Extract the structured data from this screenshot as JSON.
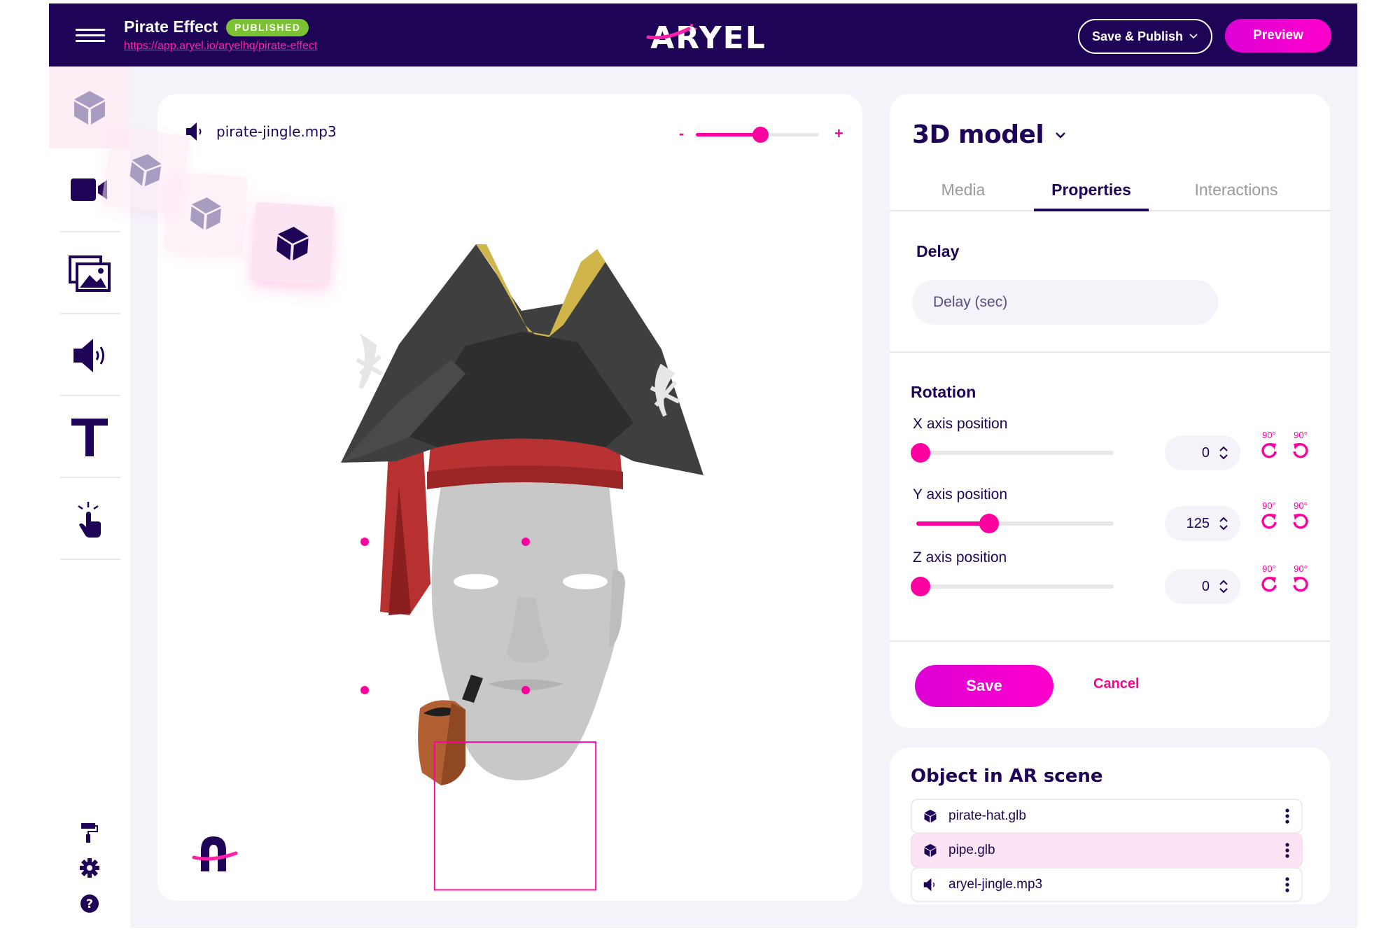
{
  "header": {
    "project_title": "Pirate Effect",
    "status_badge": "PUBLISHED",
    "project_url": "https://app.aryel.io/aryelhq/pirate-effect",
    "logo_text": "ARYEL",
    "save_publish_label": "Save & Publish",
    "preview_label": "Preview"
  },
  "sidebar": {
    "items": [
      {
        "icon": "cube-icon",
        "label": "3D model",
        "active": true
      },
      {
        "icon": "video-camera-icon",
        "label": "Video",
        "active": false
      },
      {
        "icon": "images-icon",
        "label": "Images",
        "active": false
      },
      {
        "icon": "speaker-icon",
        "label": "Audio",
        "active": false
      },
      {
        "icon": "text-icon",
        "label": "Text",
        "active": false
      },
      {
        "icon": "tap-icon",
        "label": "Interaction",
        "active": false
      }
    ],
    "tools": [
      {
        "icon": "paint-roller-icon"
      },
      {
        "icon": "gear-icon"
      },
      {
        "icon": "help-icon"
      }
    ]
  },
  "canvas": {
    "audio_file": "pirate-jingle.mp3",
    "volume": {
      "minus": "-",
      "plus": "+",
      "level": 0.52
    }
  },
  "panel": {
    "element_type": "3D model",
    "tabs": [
      {
        "label": "Media",
        "active": false
      },
      {
        "label": "Properties",
        "active": true
      },
      {
        "label": "Interactions",
        "active": false
      }
    ],
    "delay": {
      "label": "Delay",
      "placeholder": "Delay (sec)",
      "value": ""
    },
    "rotation": {
      "label": "Rotation",
      "max": 360,
      "axes": [
        {
          "label": "X axis position",
          "value": 0,
          "rotate_cw": "90°",
          "rotate_ccw": "90°"
        },
        {
          "label": "Y axis position",
          "value": 125,
          "rotate_cw": "90°",
          "rotate_ccw": "90°"
        },
        {
          "label": "Z axis position",
          "value": 0,
          "rotate_cw": "90°",
          "rotate_ccw": "90°"
        }
      ]
    },
    "save_label": "Save",
    "cancel_label": "Cancel"
  },
  "scene": {
    "title": "Object in AR scene",
    "objects": [
      {
        "name": "pirate-hat.glb",
        "icon": "cube-icon",
        "selected": false
      },
      {
        "name": "pipe.glb",
        "icon": "cube-icon",
        "selected": true
      },
      {
        "name": "aryel-jingle.mp3",
        "icon": "speaker-icon",
        "selected": false
      }
    ]
  },
  "colors": {
    "brand_dark": "#1e0456",
    "accent_pink": "#ff00a0",
    "badge_green": "#7ac231",
    "background": "#f4f3fa"
  }
}
